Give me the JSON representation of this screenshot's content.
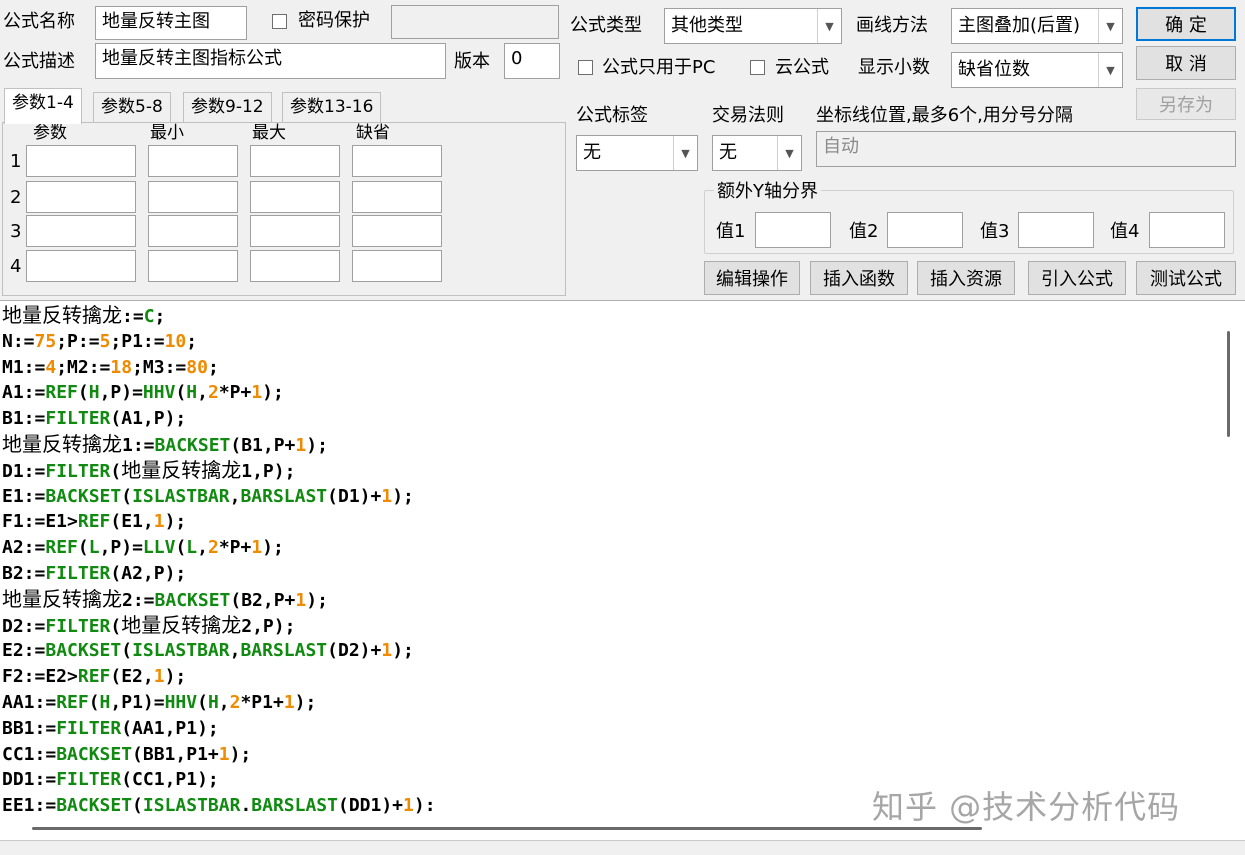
{
  "header": {
    "name_label": "公式名称",
    "name_value": "地量反转主图",
    "password_label": "密码保护",
    "desc_label": "公式描述",
    "desc_value": "地量反转主图指标公式",
    "version_label": "版本",
    "version_value": "0",
    "type_label": "公式类型",
    "type_value": "其他类型",
    "draw_label": "画线方法",
    "draw_value": "主图叠加(后置)",
    "pc_only_label": "公式只用于PC",
    "cloud_label": "云公式",
    "decimal_label": "显示小数",
    "decimal_value": "缺省位数"
  },
  "buttons": {
    "ok": "确  定",
    "cancel": "取  消",
    "save_as": "另存为",
    "edit_ops": "编辑操作",
    "insert_func": "插入函数",
    "insert_res": "插入资源",
    "import_formula": "引入公式",
    "test_formula": "测试公式"
  },
  "tabs": [
    "参数1-4",
    "参数5-8",
    "参数9-12",
    "参数13-16"
  ],
  "param_table": {
    "headers": [
      "参数",
      "最小",
      "最大",
      "缺省"
    ],
    "rows": [
      "1",
      "2",
      "3",
      "4"
    ]
  },
  "right_panel": {
    "tag_label": "公式标签",
    "tag_value": "无",
    "rule_label": "交易法则",
    "rule_value": "无",
    "axis_label": "坐标线位置,最多6个,用分号分隔",
    "axis_value": "自动",
    "yaxis_group": "额外Y轴分界",
    "val_labels": [
      "值1",
      "值2",
      "值3",
      "值4"
    ]
  },
  "code_lines": [
    [
      [
        "cjk",
        "地量反转擒龙"
      ],
      [
        "t",
        ":="
      ],
      [
        "f",
        "C"
      ],
      [
        "t",
        ";"
      ]
    ],
    [
      [
        "t",
        "N:="
      ],
      [
        "n",
        "75"
      ],
      [
        "t",
        ";P:="
      ],
      [
        "n",
        "5"
      ],
      [
        "t",
        ";P1:="
      ],
      [
        "n",
        "10"
      ],
      [
        "t",
        ";"
      ]
    ],
    [
      [
        "t",
        "M1:="
      ],
      [
        "n",
        "4"
      ],
      [
        "t",
        ";M2:="
      ],
      [
        "n",
        "18"
      ],
      [
        "t",
        ";M3:="
      ],
      [
        "n",
        "80"
      ],
      [
        "t",
        ";"
      ]
    ],
    [
      [
        "t",
        "A1:="
      ],
      [
        "f",
        "REF"
      ],
      [
        "t",
        "("
      ],
      [
        "f",
        "H"
      ],
      [
        "t",
        ",P)="
      ],
      [
        "f",
        "HHV"
      ],
      [
        "t",
        "("
      ],
      [
        "f",
        "H"
      ],
      [
        "t",
        ","
      ],
      [
        "n",
        "2"
      ],
      [
        "t",
        "*P+"
      ],
      [
        "n",
        "1"
      ],
      [
        "t",
        ");"
      ]
    ],
    [
      [
        "t",
        "B1:="
      ],
      [
        "f",
        "FILTER"
      ],
      [
        "t",
        "(A1,P);"
      ]
    ],
    [
      [
        "cjk",
        "地量反转擒龙"
      ],
      [
        "t",
        "1:="
      ],
      [
        "f",
        "BACKSET"
      ],
      [
        "t",
        "(B1,P+"
      ],
      [
        "n",
        "1"
      ],
      [
        "t",
        ");"
      ]
    ],
    [
      [
        "t",
        "D1:="
      ],
      [
        "f",
        "FILTER"
      ],
      [
        "t",
        "("
      ],
      [
        "cjk",
        "地量反转擒龙"
      ],
      [
        "t",
        "1,P);"
      ]
    ],
    [
      [
        "t",
        "E1:="
      ],
      [
        "f",
        "BACKSET"
      ],
      [
        "t",
        "("
      ],
      [
        "f",
        "ISLASTBAR"
      ],
      [
        "t",
        ","
      ],
      [
        "f",
        "BARSLAST"
      ],
      [
        "t",
        "(D1)+"
      ],
      [
        "n",
        "1"
      ],
      [
        "t",
        ");"
      ]
    ],
    [
      [
        "t",
        "F1:=E1>"
      ],
      [
        "f",
        "REF"
      ],
      [
        "t",
        "(E1,"
      ],
      [
        "n",
        "1"
      ],
      [
        "t",
        ");"
      ]
    ],
    [
      [
        "t",
        "A2:="
      ],
      [
        "f",
        "REF"
      ],
      [
        "t",
        "("
      ],
      [
        "f",
        "L"
      ],
      [
        "t",
        ",P)="
      ],
      [
        "f",
        "LLV"
      ],
      [
        "t",
        "("
      ],
      [
        "f",
        "L"
      ],
      [
        "t",
        ","
      ],
      [
        "n",
        "2"
      ],
      [
        "t",
        "*P+"
      ],
      [
        "n",
        "1"
      ],
      [
        "t",
        ");"
      ]
    ],
    [
      [
        "t",
        "B2:="
      ],
      [
        "f",
        "FILTER"
      ],
      [
        "t",
        "(A2,P);"
      ]
    ],
    [
      [
        "cjk",
        "地量反转擒龙"
      ],
      [
        "t",
        "2:="
      ],
      [
        "f",
        "BACKSET"
      ],
      [
        "t",
        "(B2,P+"
      ],
      [
        "n",
        "1"
      ],
      [
        "t",
        ");"
      ]
    ],
    [
      [
        "t",
        "D2:="
      ],
      [
        "f",
        "FILTER"
      ],
      [
        "t",
        "("
      ],
      [
        "cjk",
        "地量反转擒龙"
      ],
      [
        "t",
        "2,P);"
      ]
    ],
    [
      [
        "t",
        "E2:="
      ],
      [
        "f",
        "BACKSET"
      ],
      [
        "t",
        "("
      ],
      [
        "f",
        "ISLASTBAR"
      ],
      [
        "t",
        ","
      ],
      [
        "f",
        "BARSLAST"
      ],
      [
        "t",
        "(D2)+"
      ],
      [
        "n",
        "1"
      ],
      [
        "t",
        ");"
      ]
    ],
    [
      [
        "t",
        "F2:=E2>"
      ],
      [
        "f",
        "REF"
      ],
      [
        "t",
        "(E2,"
      ],
      [
        "n",
        "1"
      ],
      [
        "t",
        ");"
      ]
    ],
    [
      [
        "t",
        "AA1:="
      ],
      [
        "f",
        "REF"
      ],
      [
        "t",
        "("
      ],
      [
        "f",
        "H"
      ],
      [
        "t",
        ",P1)="
      ],
      [
        "f",
        "HHV"
      ],
      [
        "t",
        "("
      ],
      [
        "f",
        "H"
      ],
      [
        "t",
        ","
      ],
      [
        "n",
        "2"
      ],
      [
        "t",
        "*P1+"
      ],
      [
        "n",
        "1"
      ],
      [
        "t",
        ");"
      ]
    ],
    [
      [
        "t",
        "BB1:="
      ],
      [
        "f",
        "FILTER"
      ],
      [
        "t",
        "(AA1,P1);"
      ]
    ],
    [
      [
        "t",
        "CC1:="
      ],
      [
        "f",
        "BACKSET"
      ],
      [
        "t",
        "(BB1,P1+"
      ],
      [
        "n",
        "1"
      ],
      [
        "t",
        ");"
      ]
    ],
    [
      [
        "t",
        "DD1:="
      ],
      [
        "f",
        "FILTER"
      ],
      [
        "t",
        "(CC1,P1);"
      ]
    ],
    [
      [
        "t",
        "EE1:="
      ],
      [
        "f",
        "BACKSET"
      ],
      [
        "t",
        "("
      ],
      [
        "f",
        "ISLASTBAR"
      ],
      [
        "t",
        "."
      ],
      [
        "f",
        "BARSLAST"
      ],
      [
        "t",
        "(DD1)+"
      ],
      [
        "n",
        "1"
      ],
      [
        "t",
        "):"
      ]
    ]
  ],
  "watermark": "知乎 @技术分析代码",
  "colors": {
    "function": "#108a10",
    "number": "#f08a00",
    "text": "#000000",
    "accent": "#0078d7"
  }
}
